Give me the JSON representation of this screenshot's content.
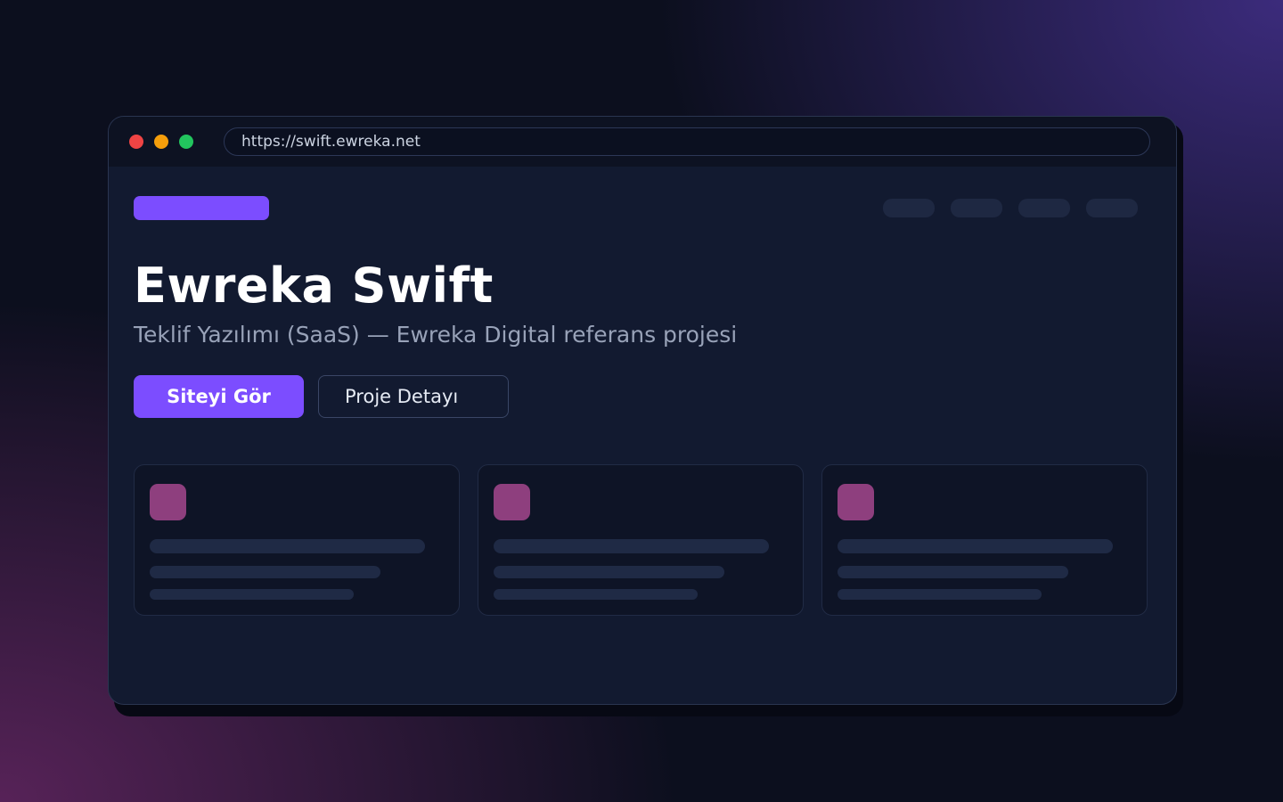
{
  "browser": {
    "url": "https://swift.ewreka.net"
  },
  "hero": {
    "title": "Ewreka Swift",
    "subtitle": "Teklif Yazılımı (SaaS) — Ewreka Digital referans projesi",
    "primary_button": "Siteyi Gör",
    "secondary_button": "Proje Detayı"
  },
  "colors": {
    "accent": "#7c4dff",
    "card_icon": "#8e3f7e",
    "window_bg": "#121a30",
    "close_dot": "#ef4444",
    "minimize_dot": "#f59e0b",
    "maximize_dot": "#22c55e"
  }
}
